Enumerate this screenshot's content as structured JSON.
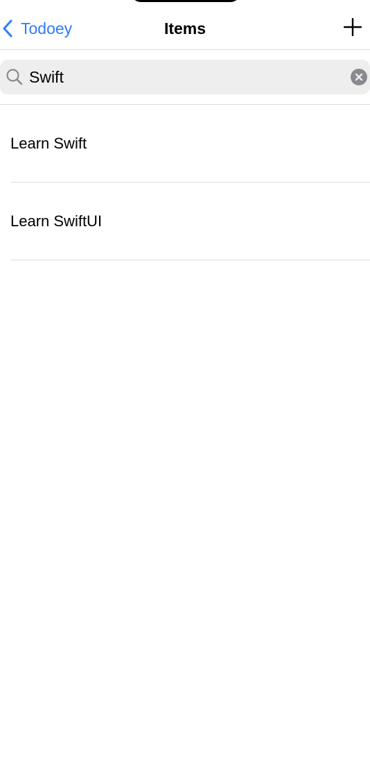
{
  "nav": {
    "back_label": "Todoey",
    "title": "Items",
    "back_icon": "chevron-left-icon",
    "add_icon": "plus-icon"
  },
  "search": {
    "value": "Swift",
    "icon": "search-icon",
    "clear_icon": "clear-circle-icon"
  },
  "items": [
    {
      "label": "Learn Swift"
    },
    {
      "label": "Learn SwiftUI"
    }
  ],
  "colors": {
    "accent": "#2f7cf6",
    "search_background": "#eeeeef",
    "separator": "#dcdcdc"
  }
}
